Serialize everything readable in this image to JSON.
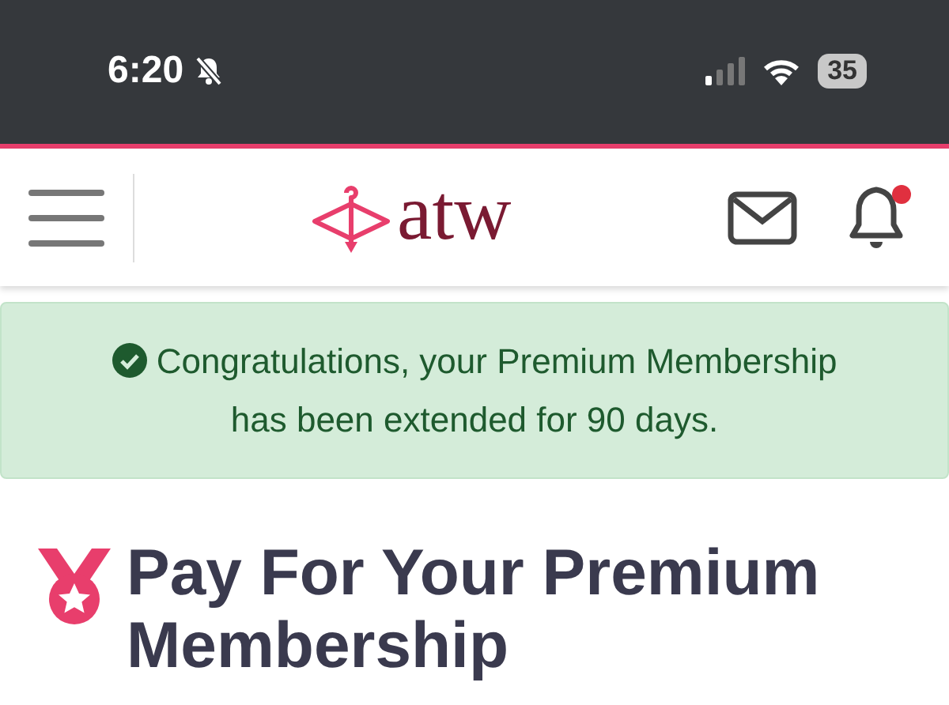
{
  "status_bar": {
    "time": "6:20",
    "silenced": true,
    "battery": "35"
  },
  "header": {
    "logo_text": "atw",
    "notifications": {
      "unread": true
    }
  },
  "alert": {
    "kind": "success",
    "text": "Congratulations, your Premium Membership has been extended for 90 days."
  },
  "heading": {
    "text": "Pay For Your Premium Membership"
  }
}
